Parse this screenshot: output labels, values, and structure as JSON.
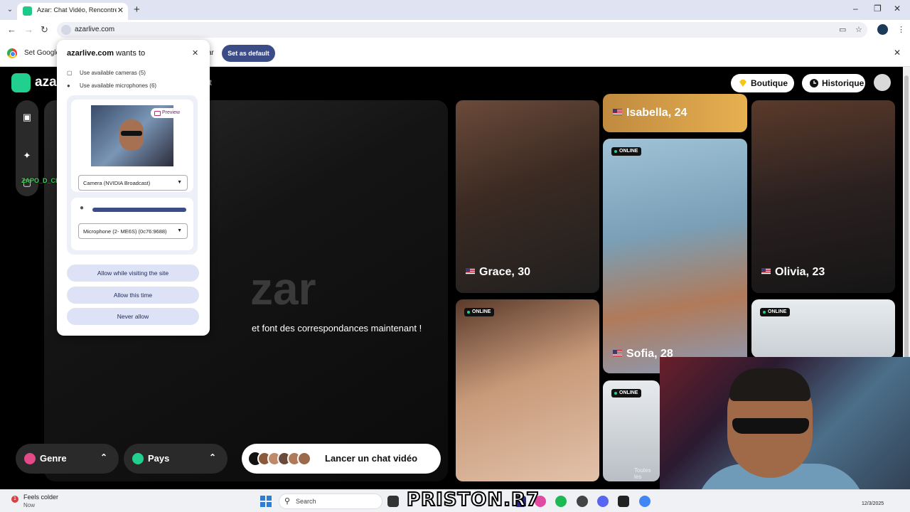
{
  "browser": {
    "tab_title": "Azar: Chat Vidéo, Rencontrer de",
    "url": "azarlive.com",
    "infobar": {
      "text": "Set Google",
      "text_tail": "ar",
      "set_default_label": "Set as default"
    }
  },
  "permission_popup": {
    "site": "azarlive.com",
    "title_suffix": "wants to",
    "cameras_line": "Use available cameras (5)",
    "microphones_line": "Use available microphones (6)",
    "preview_label": "Preview",
    "camera_select": "Camera (NVIDIA Broadcast)",
    "microphone_select": "Microphone (2- ME6S) (0c76:9688)",
    "mic_level": 1.0,
    "buttons": {
      "allow_visit": "Allow while visiting the site",
      "allow_once": "Allow this time",
      "never": "Never allow"
    }
  },
  "app": {
    "logo": "azar",
    "logo_tail": "t",
    "boutique_label": "Boutique",
    "historique_label": "Historique",
    "hero_brand": "zar",
    "hero_text": "et font des correspondances maintenant !",
    "genre_label": "Genre",
    "pays_label": "Pays",
    "cta_label": "Lancer un chat vidéo",
    "watermark": "ZAPO_D_CHAT",
    "profiles": [
      {
        "name": "Isabella, 24"
      },
      {
        "name": "Grace, 30"
      },
      {
        "name": "Sofia, 28",
        "status": "ONLINE"
      },
      {
        "name": "Olivia, 23"
      },
      {
        "status": "ONLINE"
      },
      {
        "status": "ONLINE"
      },
      {
        "status": "ONLINE",
        "caption": "Toutes les"
      }
    ]
  },
  "taskbar": {
    "weather_badge": "1",
    "weather": "Feels colder",
    "weather_sub": "Now",
    "search_label": "Search",
    "clock": "12/3/2025",
    "overlay": "PRISTON.R7"
  },
  "colors": {
    "accent": "#3c4c86",
    "brand": "#21d08f",
    "permission_button": "#dde2f7"
  }
}
